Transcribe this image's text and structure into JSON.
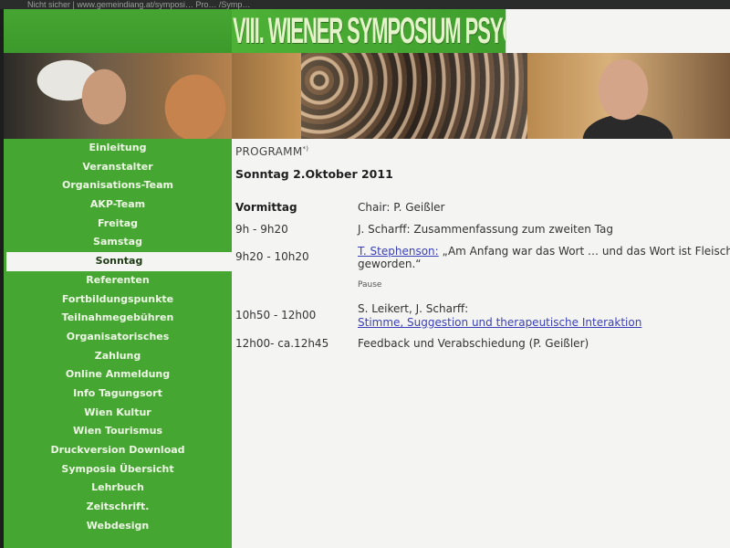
{
  "browser": {
    "address_text": "Nicht sicher  |  www.gemeindiang.at/symposi… Pro… /Symp…"
  },
  "header": {
    "title": "VIII. WIENER SYMPOSIUM PSYCHOANALYSE & KöRPER"
  },
  "sidebar": {
    "items": [
      {
        "label": "Einleitung",
        "active": false
      },
      {
        "label": "Veranstalter",
        "active": false
      },
      {
        "label": "Organisations-Team",
        "active": false
      },
      {
        "label": "AKP-Team",
        "active": false
      },
      {
        "label": "Freitag",
        "active": false
      },
      {
        "label": "Samstag",
        "active": false
      },
      {
        "label": "Sonntag",
        "active": true
      },
      {
        "label": "Referenten",
        "active": false
      },
      {
        "label": "Fortbildungspunkte",
        "active": false
      },
      {
        "label": "Teilnahmegebühren",
        "active": false
      },
      {
        "label": "Organisatorisches",
        "active": false
      },
      {
        "label": "Zahlung",
        "active": false
      },
      {
        "label": "Online Anmeldung",
        "active": false
      },
      {
        "label": "Info Tagungsort",
        "active": false
      },
      {
        "label": "Wien Kultur",
        "active": false
      },
      {
        "label": "Wien Tourismus",
        "active": false
      },
      {
        "label": "Druckversion Download",
        "active": false
      },
      {
        "label": "Symposia Übersicht",
        "active": false
      },
      {
        "label": "Lehrbuch",
        "active": false
      },
      {
        "label": "Zeitschrift.",
        "active": false
      },
      {
        "label": "Webdesign",
        "active": false
      }
    ]
  },
  "content": {
    "program_label": "PROGRAMM",
    "program_sup": "*)",
    "date": "Sonntag 2.Oktober 2011",
    "section": "Vormittag",
    "chair": "Chair: P. Geißler",
    "rows": [
      {
        "time": "9h - 9h20",
        "text": "J. Scharff: Zusammenfassung zum zweiten Tag"
      },
      {
        "time": "9h20 - 10h20",
        "link": "T. Stephenson:",
        "text": " „Am Anfang war das Wort … und das Wort ist Fleisch",
        "text2": "geworden.“"
      },
      {
        "pause": "Pause"
      },
      {
        "time": "10h50 - 12h00",
        "text": "S. Leikert, J. Scharff:",
        "link2": "Stimme, Suggestion und therapeutische Interaktion"
      },
      {
        "time": "12h00- ca.12h45",
        "text": "Feedback und Verabschiedung (P. Geißler)"
      }
    ]
  }
}
